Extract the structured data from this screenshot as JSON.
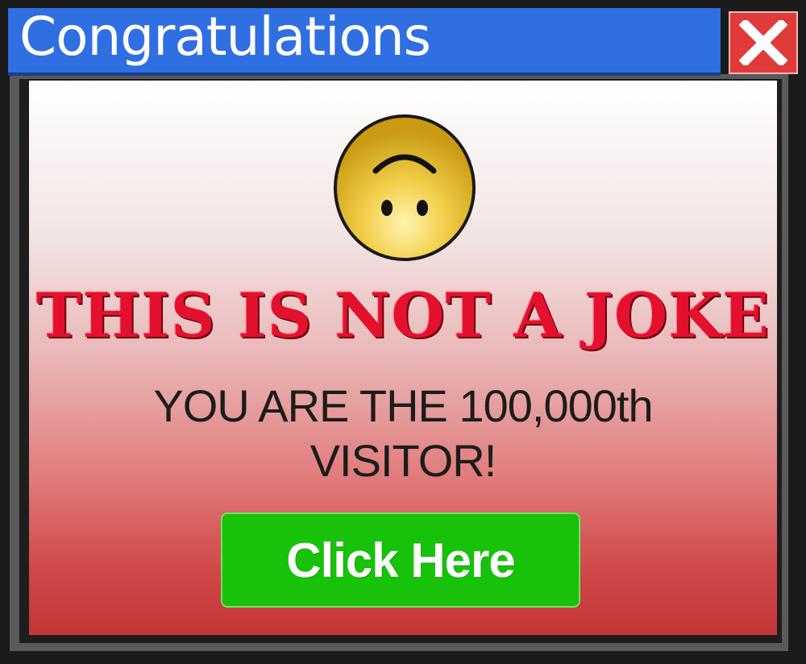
{
  "window": {
    "title": "Congratulations",
    "close_icon": "close-x-icon",
    "colors": {
      "titlebar": "#2f6fe2",
      "close": "#e13a3a",
      "frame": "#1b1b1b"
    }
  },
  "content": {
    "icon": "upside-down-smiley-icon",
    "headline": "THIS IS NOT A JOKE",
    "message_line1": "YOU ARE THE 100,000th",
    "message_line2": "VISITOR!",
    "button_label": "Click Here",
    "colors": {
      "headline": "#e3112d",
      "button": "#18c20a",
      "gradient_top": "#ffffff",
      "gradient_bottom": "#c43636"
    }
  }
}
